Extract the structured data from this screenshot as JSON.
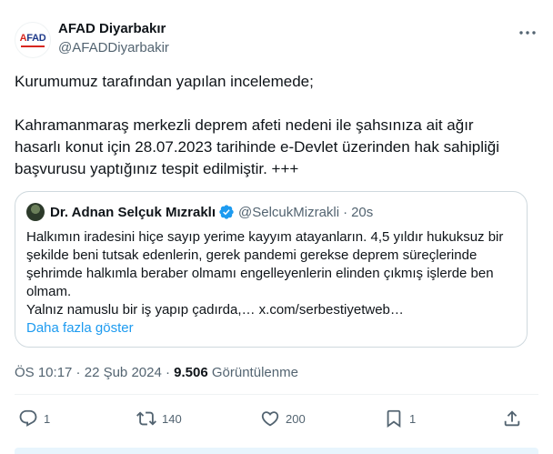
{
  "author": {
    "display_name": "AFAD Diyarbakır",
    "handle": "@AFADDiyarbakir",
    "logo_text": "AFAD"
  },
  "tweet": {
    "line1": "Kurumumuz tarafından yapılan incelemede;",
    "line2": "Kahramanmaraş merkezli deprem afeti nedeni ile şahsınıza ait ağır hasarlı konut için 28.07.2023 tarihinde e-Devlet üzerinden hak sahipliği başvurusu yaptığınız tespit edilmiştir.  +++"
  },
  "quote": {
    "display_name": "Dr. Adnan Selçuk Mızraklı",
    "handle": "@SelcukMizrakli",
    "separator": "·",
    "time": "20s",
    "paragraph1": "Halkımın iradesini hiçe sayıp yerime kayyım atayanların. 4,5 yıldır hukuksuz bir şekilde beni tutsak edenlerin, gerek pandemi gerekse deprem süreçlerinde şehrimde halkımla beraber olmamı engelleyenlerin elinden çıkmış işlerde ben olmam.",
    "paragraph2": "Yalnız namuslu bir iş yapıp çadırda,… x.com/serbestiyetweb…",
    "show_more": "Daha fazla göster"
  },
  "meta": {
    "time": "ÖS 10:17",
    "sep1": " · ",
    "date": "22 Şub 2024",
    "sep2": " · ",
    "views_count": "9.506",
    "views_label": " Görüntülenme"
  },
  "actions": {
    "replies": "1",
    "reposts": "140",
    "likes": "200",
    "bookmarks": "1"
  },
  "icons": {
    "more": "more-dots-icon",
    "verified": "verified-badge-icon",
    "reply": "reply-icon",
    "retweet": "retweet-icon",
    "like": "heart-icon",
    "bookmark": "bookmark-icon",
    "share": "share-icon"
  },
  "colors": {
    "accent": "#1d9bf0",
    "text": "#0f1419",
    "secondary": "#536471",
    "border": "#cfd9de"
  }
}
